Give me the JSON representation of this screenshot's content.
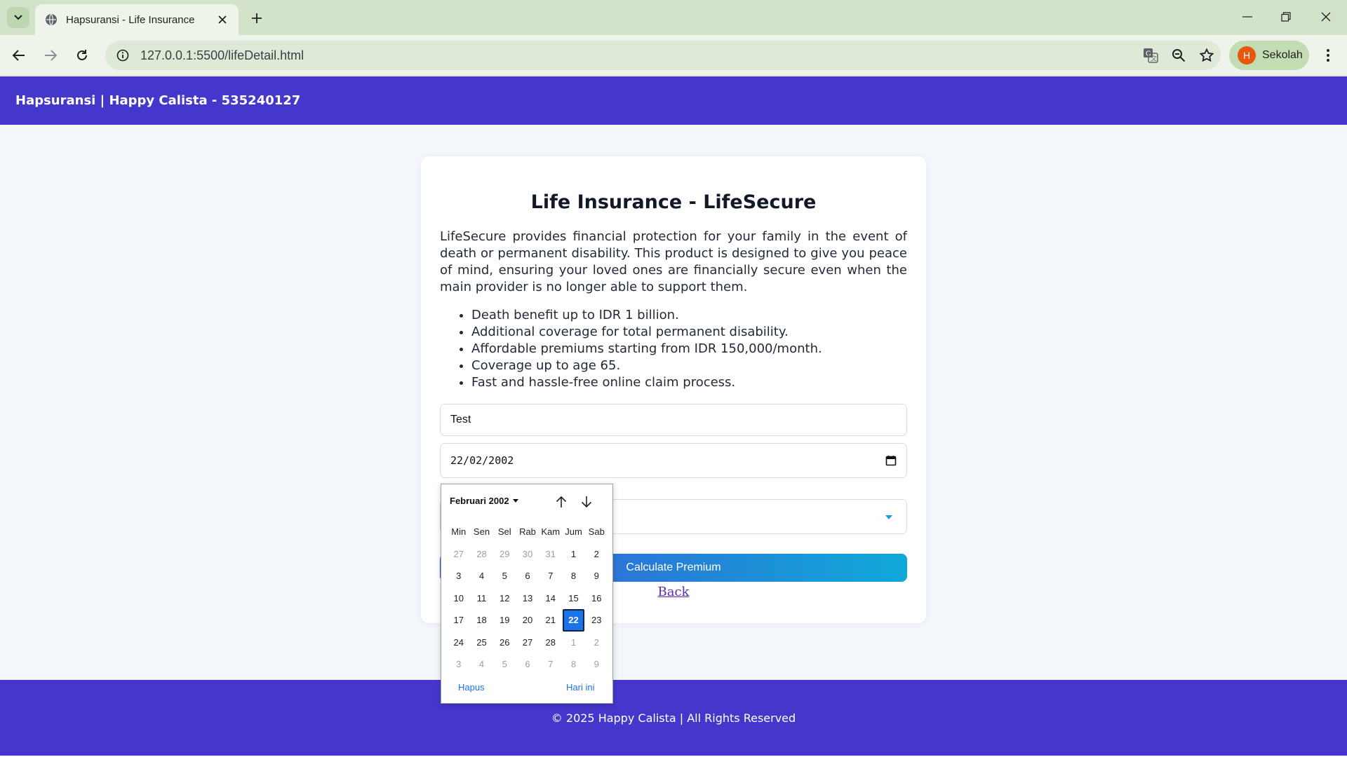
{
  "browser": {
    "tab_title": "Hapsuransi - Life Insurance",
    "url": "127.0.0.1:5500/lifeDetail.html",
    "profile_initial": "H",
    "profile_name": "Sekolah"
  },
  "header": {
    "brand": "Hapsuransi | Happy Calista - 535240127"
  },
  "card": {
    "title": "Life Insurance - LifeSecure",
    "description": "LifeSecure provides financial protection for your family in the event of death or permanent disability. This product is designed to give you peace of mind, ensuring your loved ones are financially secure even when the main provider is no longer able to support them.",
    "features": [
      "Death benefit up to IDR 1 billion.",
      "Additional coverage for total permanent disability.",
      "Affordable premiums starting from IDR 150,000/month.",
      "Coverage up to age 65.",
      "Fast and hassle-free online claim process."
    ],
    "name_value": "Test",
    "date_value": "22/02/2002",
    "calc_button": "Calculate Premium",
    "back_link": "Back"
  },
  "datepicker": {
    "month_label": "Februari 2002",
    "weekdays": [
      "Min",
      "Sen",
      "Sel",
      "Rab",
      "Kam",
      "Jum",
      "Sab"
    ],
    "weeks": [
      [
        "27",
        "28",
        "29",
        "30",
        "31",
        "1",
        "2"
      ],
      [
        "3",
        "4",
        "5",
        "6",
        "7",
        "8",
        "9"
      ],
      [
        "10",
        "11",
        "12",
        "13",
        "14",
        "15",
        "16"
      ],
      [
        "17",
        "18",
        "19",
        "20",
        "21",
        "22",
        "23"
      ],
      [
        "24",
        "25",
        "26",
        "27",
        "28",
        "1",
        "2"
      ],
      [
        "3",
        "4",
        "5",
        "6",
        "7",
        "8",
        "9"
      ]
    ],
    "selected_day": "22",
    "clear_label": "Hapus",
    "today_label": "Hari ini"
  },
  "footer": {
    "copyright": "© 2025 Happy Calista | All Rights Reserved"
  },
  "colors": {
    "brand": "#4537cc",
    "button_gradient_start": "#3b57d6",
    "button_gradient_end": "#10a9d8",
    "selected_day": "#1a73e8"
  },
  "icons": [
    "tab-search-icon",
    "globe-icon",
    "close-icon",
    "plus-icon",
    "minimize-icon",
    "restore-icon",
    "back-arrow-icon",
    "forward-arrow-icon",
    "reload-icon",
    "site-info-icon",
    "translate-icon",
    "zoom-icon",
    "bookmark-star-icon",
    "kebab-menu-icon",
    "calendar-icon",
    "arrow-up-icon",
    "arrow-down-icon"
  ]
}
